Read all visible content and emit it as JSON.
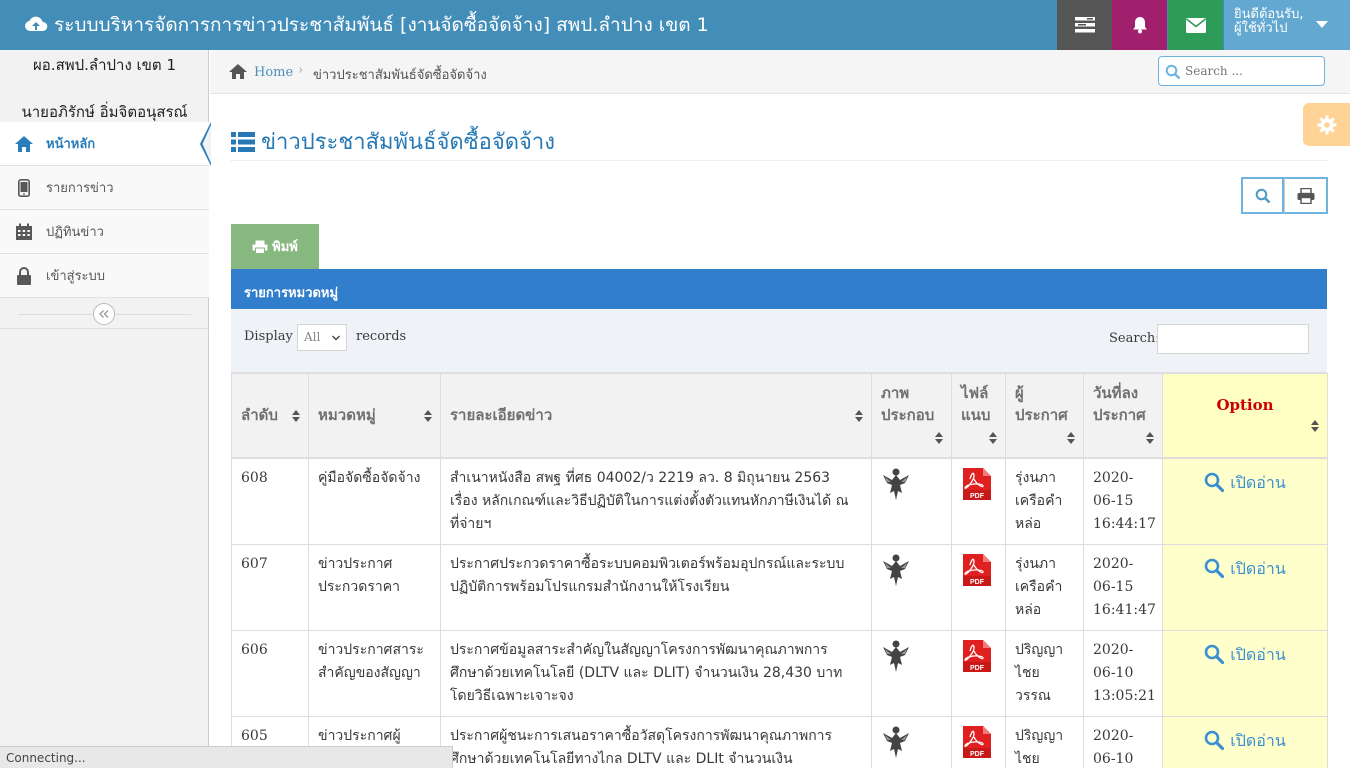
{
  "app": {
    "title": "ระบบบริหารจัดการการข่าวประชาสัมพันธ์ [งานจัดซื้อจัดจ้าง] สพป.ลำปาง เขต 1",
    "welcome": "ยินดีต้อนรับ,",
    "user_role": "ผู้ใช้ทั่วไป",
    "icons": [
      "cloud-upload-icon",
      "tasks-icon",
      "bell-icon",
      "envelope-icon",
      "caret-down-icon"
    ]
  },
  "sidebar": {
    "org": "ผอ.สพป.ลำปาง เขต 1",
    "person": "นายอภิรักษ์ อิ่มจิตอนุสรณ์",
    "items": [
      {
        "label": "หน้าหลัก",
        "icon": "home-icon"
      },
      {
        "label": "รายการข่าว",
        "icon": "tablet-icon"
      },
      {
        "label": "ปฏิทินข่าว",
        "icon": "calendar-icon"
      },
      {
        "label": "เข้าสู่ระบบ",
        "icon": "lock-icon"
      }
    ],
    "collapse_icon": "double-angle-left-icon"
  },
  "breadcrumb": {
    "home": "Home",
    "current": "ข่าวประชาสัมพันธ์จัดซื้อจัดจ้าง",
    "search_placeholder": "Search ..."
  },
  "page": {
    "title": "ข่าวประชาสัมพันธ์จัดซื้อจัดจ้าง",
    "print_tab": "พิมพ์",
    "table_caption": "รายการหมวดหมู่"
  },
  "controls": {
    "display_label": "Display",
    "display_value": "All",
    "records_label": "records",
    "search_label": "Search:"
  },
  "table": {
    "headers": {
      "no": "ลำดับ",
      "category": "หมวดหมู่",
      "detail": "รายละเอียดข่าว",
      "image": "ภาพประกอบ",
      "file": "ไฟล์แนบ",
      "author": "ผู้ประกาศ",
      "date": "วันที่ลงประกาศ",
      "option": "Option"
    },
    "rows": [
      {
        "no": "608",
        "category": "คู่มือจัดซื้อจัดจ้าง",
        "detail": "สำเนาหนังสือ สพฐ ที่ศธ 04002/ว 2219 ลว. 8 มิถุนายน 2563 เรื่อง หลักเกณฑ์และวิธีปฏิบัติในการแต่งตั้งตัวแทนหักภาษีเงินได้ ณ ที่จ่ายฯ",
        "author": "รุ่งนภา เครือคำหล่อ",
        "date": "2020-06-15 16:44:17",
        "action": "เปิดอ่าน"
      },
      {
        "no": "607",
        "category": "ข่าวประกาศประกวดราคา",
        "detail": "ประกาศประกวดราคาซื้อระบบคอมพิวเตอร์พร้อมอุปกรณ์และระบบปฏิบัติการพร้อมโปรแกรมสำนักงานให้โรงเรียน",
        "author": "รุ่งนภา เครือคำหล่อ",
        "date": "2020-06-15 16:41:47",
        "action": "เปิดอ่าน"
      },
      {
        "no": "606",
        "category": "ข่าวประกาศสาระสำคัญของสัญญา",
        "detail": "ประกาศข้อมูลสาระสำคัญในสัญญาโครงการพัฒนาคุณภาพการศึกษาด้วยเทคโนโลยี (DLTV และ DLIT) จำนวนเงิน 28,430 บาท โดยวิธีเฉพาะเจาะจง",
        "author": "ปริญญา ไชยวรรณ",
        "date": "2020-06-10 13:05:21",
        "action": "เปิดอ่าน"
      },
      {
        "no": "605",
        "category": "ข่าวประกาศผู้",
        "detail": "ประกาศผู้ชนะการเสนอราคาซื้อวัสดุโครงการพัฒนาคุณภาพการศึกษาด้วยเทคโนโลยีทางไกล DLTV และ DLIt จำนวนเงิน",
        "author": "ปริญญา ไชย",
        "date": "2020-06-10",
        "action": "เปิดอ่าน"
      }
    ]
  },
  "status_bar": "Connecting..."
}
